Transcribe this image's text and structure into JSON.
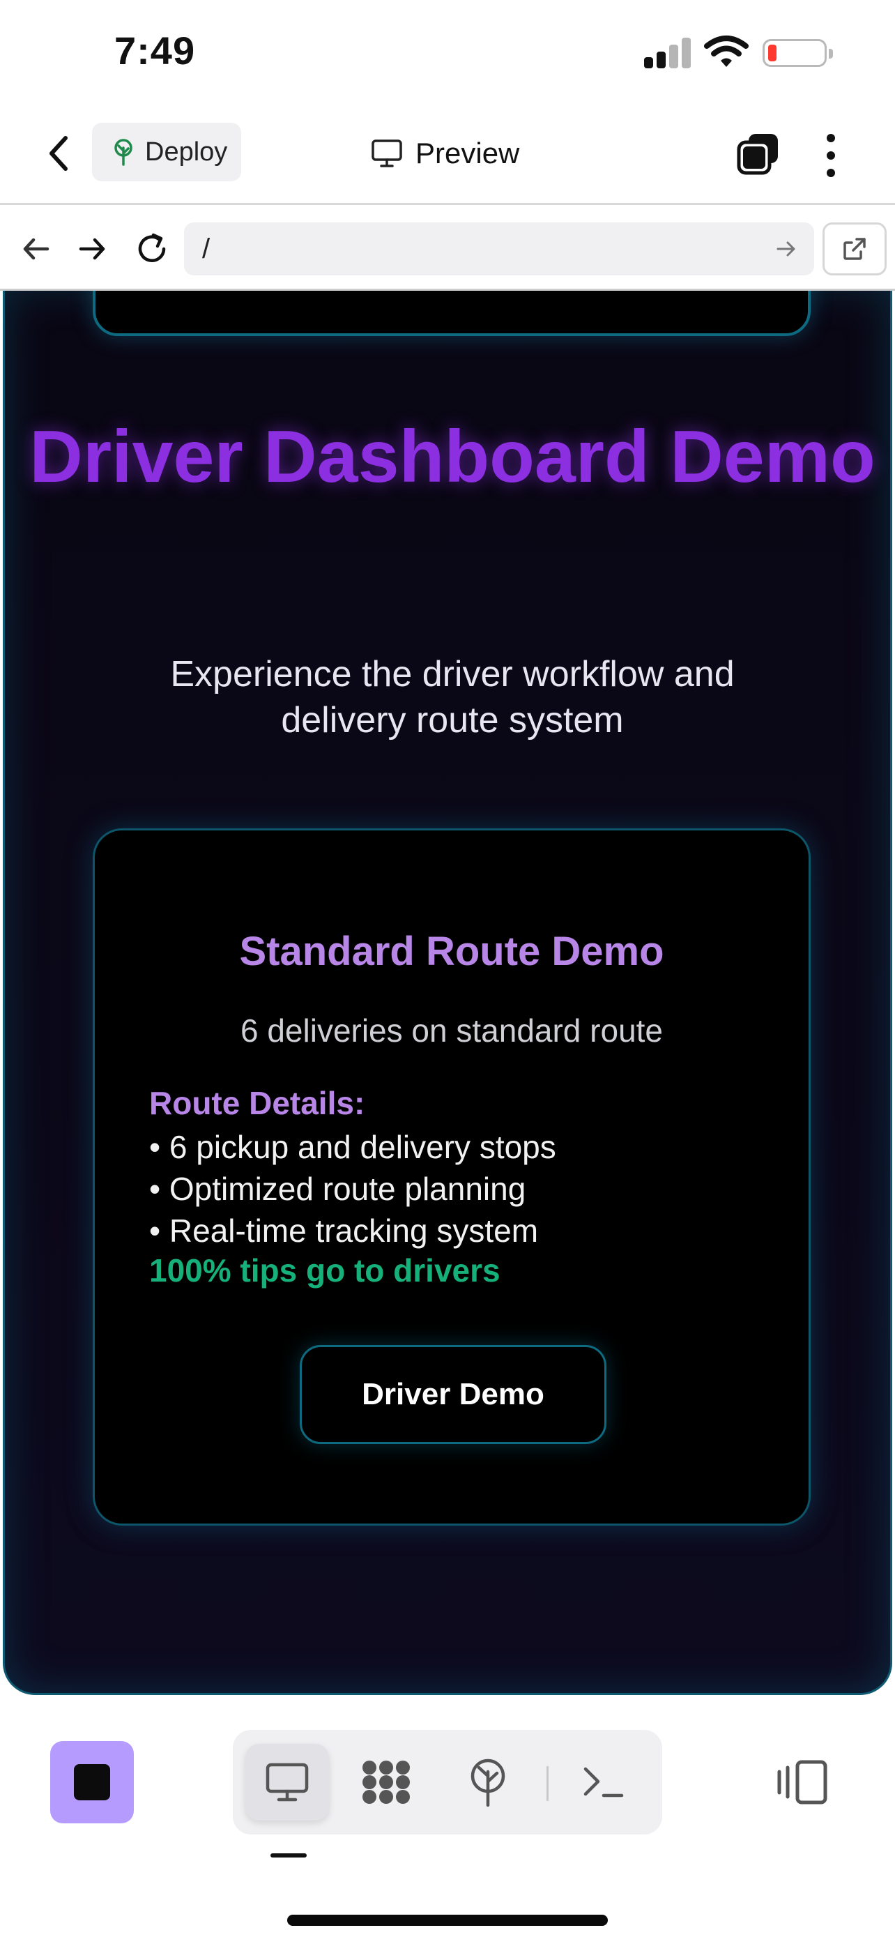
{
  "status": {
    "time": "7:49"
  },
  "appbar": {
    "deploy_label": "Deploy",
    "preview_label": "Preview"
  },
  "urlbar": {
    "url": "/"
  },
  "hero": {
    "title": "Driver Dashboard Demo",
    "subtitle": "Experience the driver workflow and delivery route system"
  },
  "card": {
    "title": "Standard Route Demo",
    "subtitle": "6 deliveries on standard route",
    "details_heading": "Route Details:",
    "bullets": [
      "• 6 pickup and delivery stops",
      "• Optimized route planning",
      "• Real-time tracking system"
    ],
    "tips": "100% tips go to drivers",
    "button_label": "Driver Demo"
  },
  "colors": {
    "title_purple": "#8b2fe0",
    "accent_lavender": "#b886e6",
    "tips_green": "#16b07a",
    "border_teal": "#0e6a80",
    "stop_button": "#b69bff"
  },
  "icons": {
    "back": "chevron-left-icon",
    "deploy": "deploy-tree-icon",
    "preview": "monitor-icon",
    "tabs": "tabs-icon",
    "more": "more-vertical-icon",
    "nav_back": "arrow-left-icon",
    "nav_forward": "arrow-right-icon",
    "reload": "reload-icon",
    "go": "arrow-right-small-icon",
    "open_external": "open-external-icon",
    "stop": "stop-icon",
    "desktop": "desktop-icon",
    "workspace": "workspace-grid-icon",
    "deploy_tab": "deploy-tab-icon",
    "shell": "terminal-icon",
    "sidebar": "sidebar-toggle-icon"
  }
}
